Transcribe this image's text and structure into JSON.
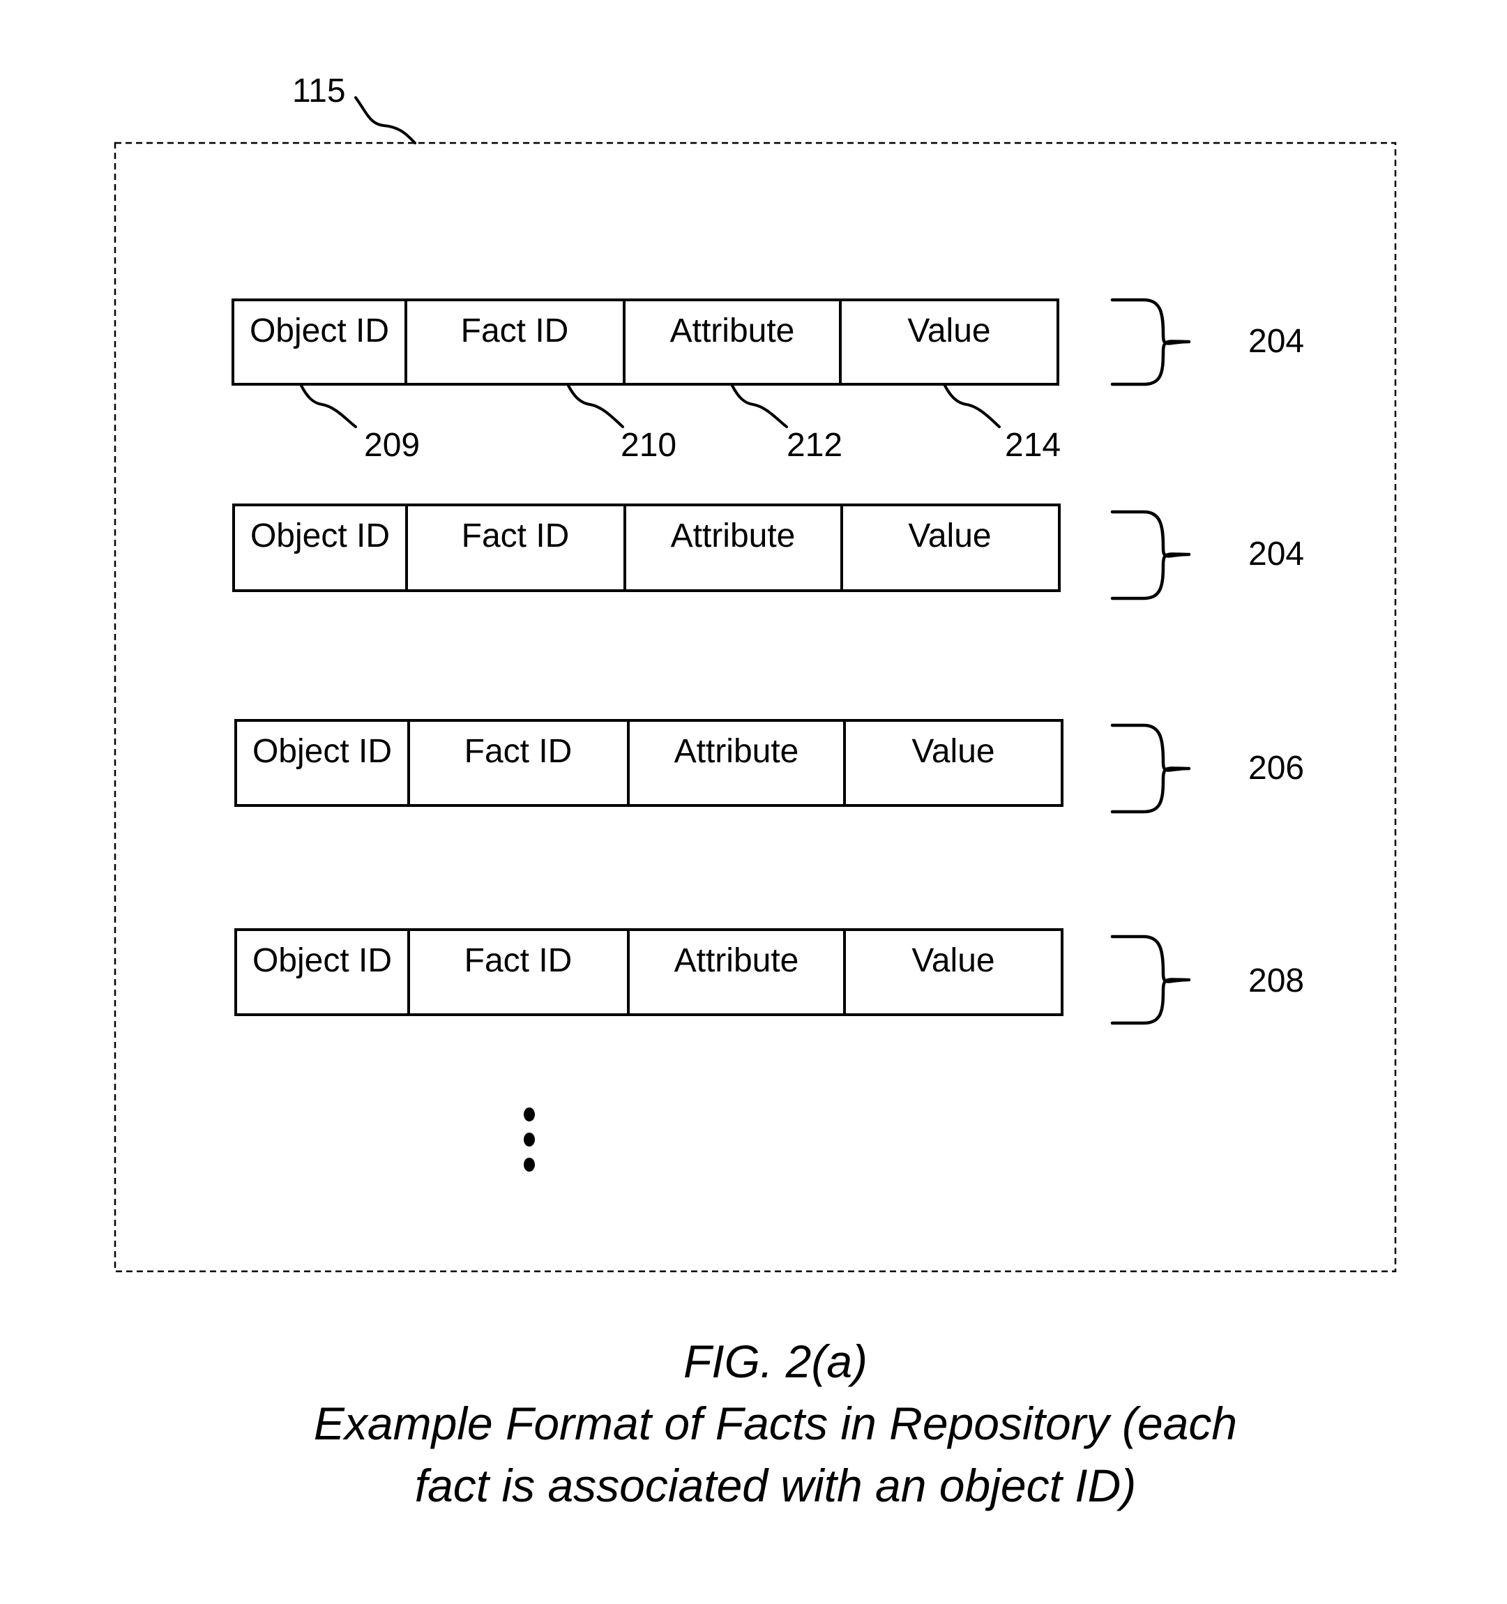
{
  "figure": {
    "container_label": "115",
    "fields": [
      "Object ID",
      "Fact ID",
      "Attribute",
      "Value"
    ],
    "field_callouts": [
      "209",
      "210",
      "212",
      "214"
    ],
    "rows": [
      {
        "label": "204"
      },
      {
        "label": "204"
      },
      {
        "label": "206"
      },
      {
        "label": "208"
      }
    ],
    "continuation": "ellipsis-vertical"
  },
  "caption": {
    "title": "FIG. 2(a)",
    "line1": "Example Format of Facts in Repository (each",
    "line2": "fact is associated with an object ID)"
  }
}
